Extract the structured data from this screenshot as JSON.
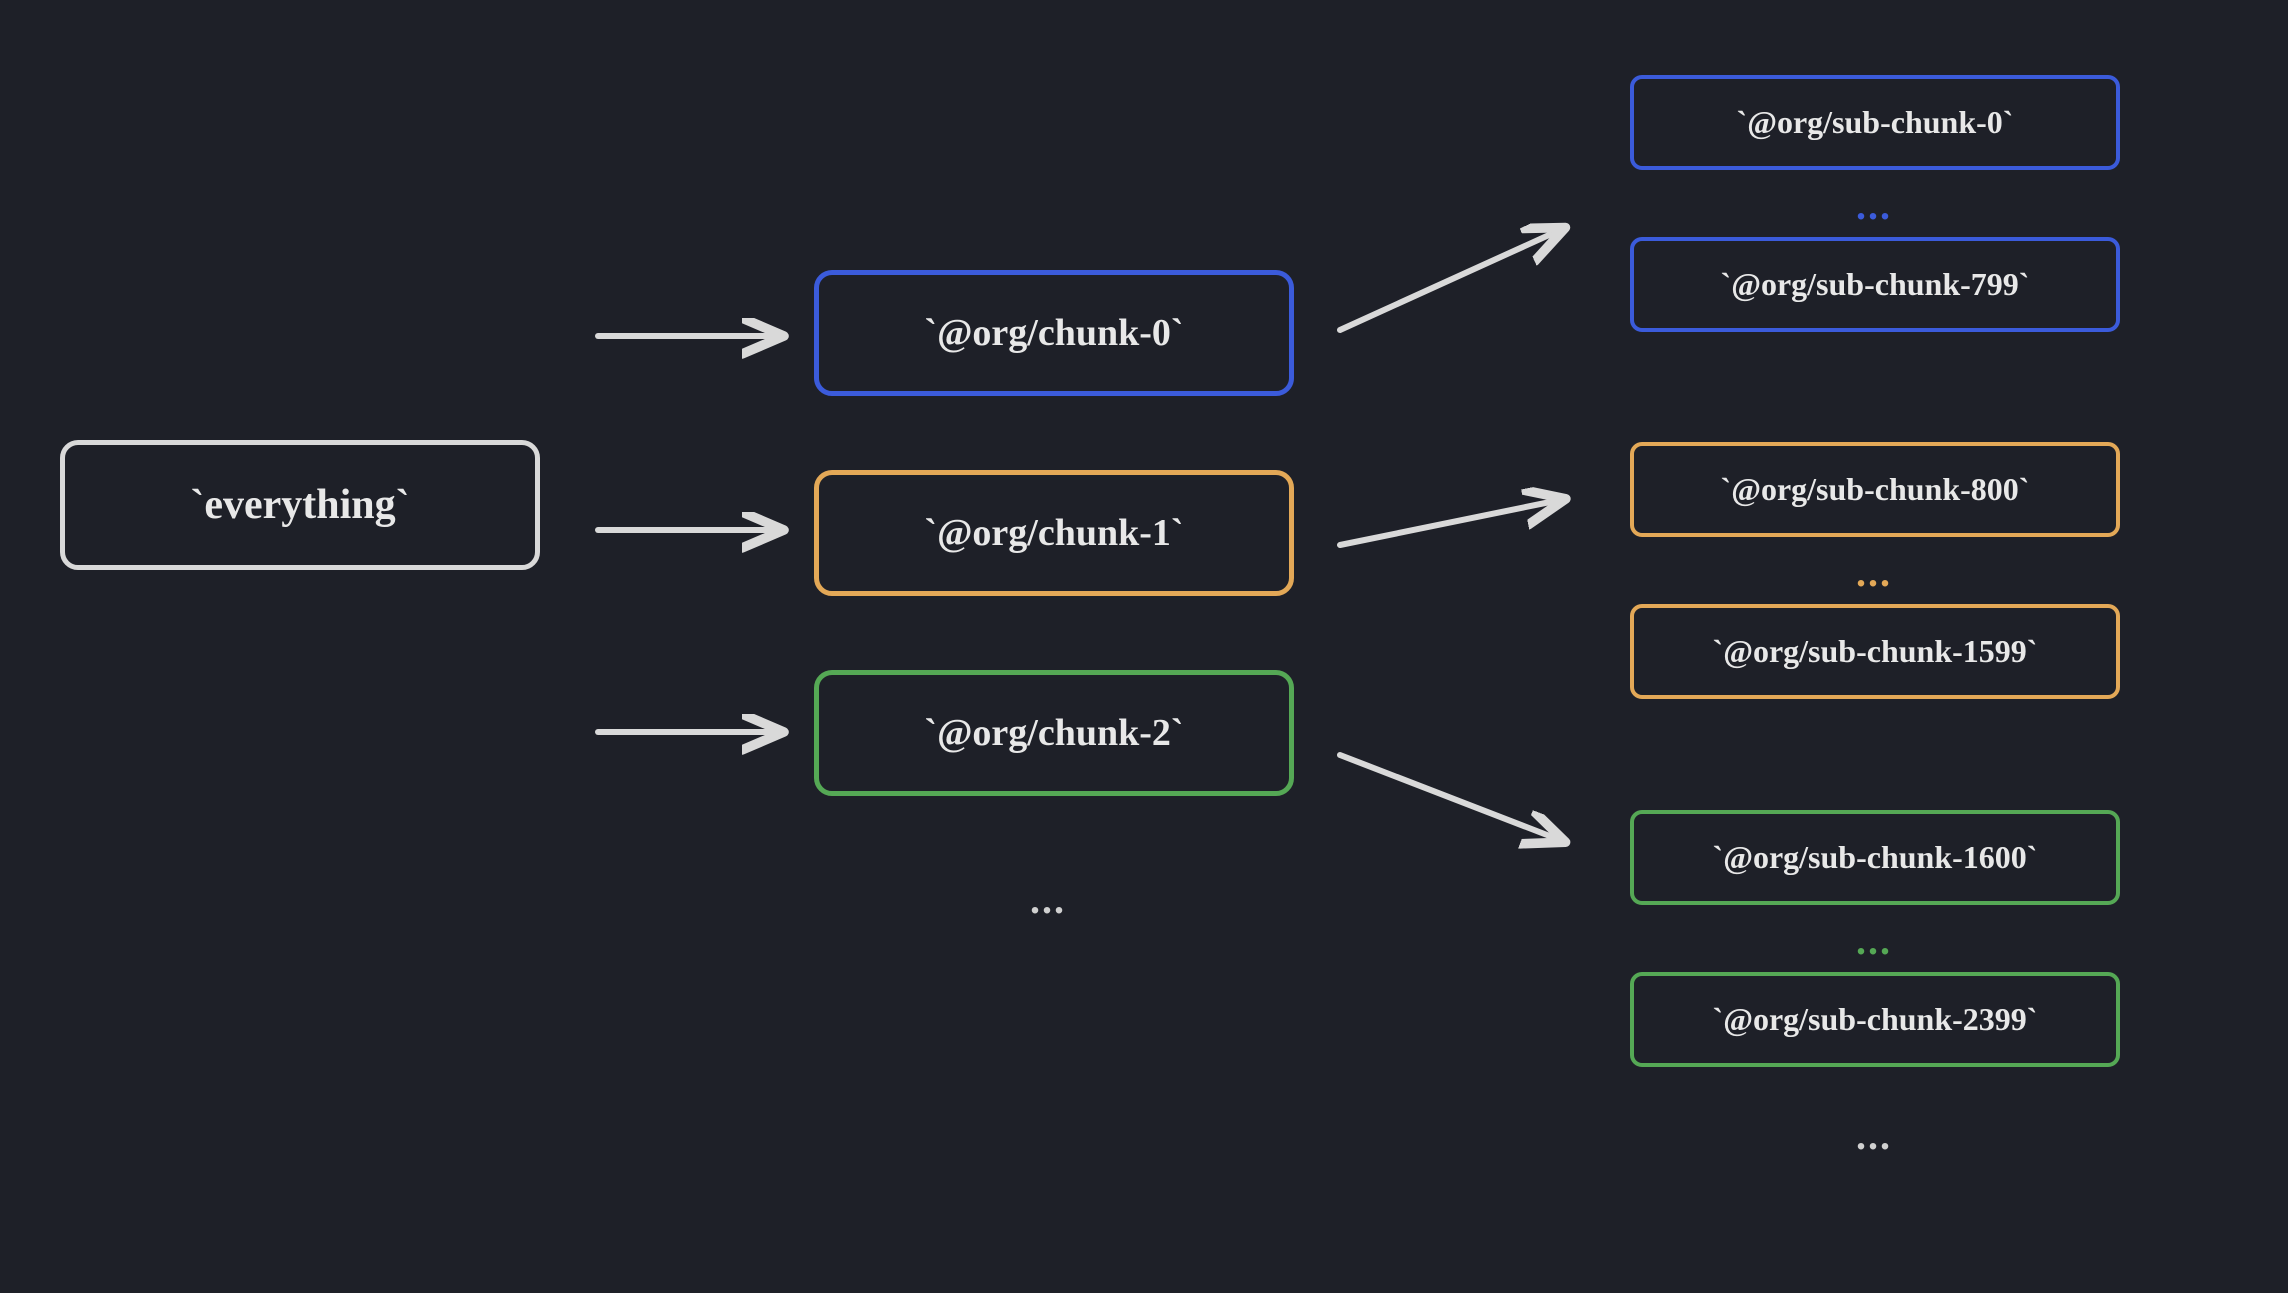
{
  "root": {
    "label": "`everything`"
  },
  "chunks": [
    {
      "label": "`@org/chunk-0`",
      "color": "#3b5bdb"
    },
    {
      "label": "`@org/chunk-1`",
      "color": "#e3a857"
    },
    {
      "label": "`@org/chunk-2`",
      "color": "#55a855"
    }
  ],
  "subchunks": {
    "group0": [
      {
        "label": "`@org/sub-chunk-0`"
      },
      {
        "label": "`@org/sub-chunk-799`"
      }
    ],
    "group1": [
      {
        "label": "`@org/sub-chunk-800`"
      },
      {
        "label": "`@org/sub-chunk-1599`"
      }
    ],
    "group2": [
      {
        "label": "`@org/sub-chunk-1600`"
      },
      {
        "label": "`@org/sub-chunk-2399`"
      }
    ]
  },
  "ellipsis": "...",
  "colors": {
    "background": "#1e2028",
    "root": "#d9d9d9",
    "blue": "#3b5bdb",
    "orange": "#e3a857",
    "green": "#55a855",
    "text": "#e8e8e8"
  }
}
